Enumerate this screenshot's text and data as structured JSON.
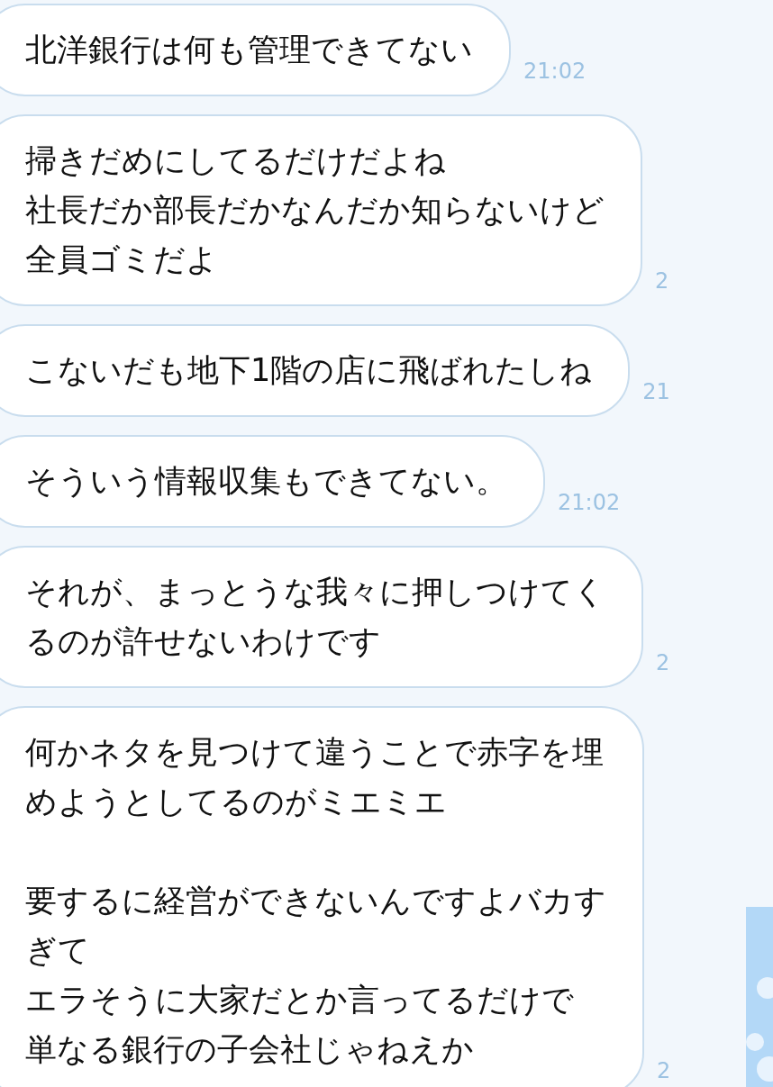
{
  "messages": [
    {
      "paragraphs": [
        [
          "北洋銀行は何も管理できてない"
        ]
      ],
      "time": "21:02"
    },
    {
      "paragraphs": [
        [
          "掃きだめにしてるだけだよね",
          "社長だか部長だかなんだか知らないけど",
          "全員ゴミだよ"
        ]
      ],
      "time": "2"
    },
    {
      "paragraphs": [
        [
          "こないだも地下1階の店に飛ばれたしね"
        ]
      ],
      "time": "21"
    },
    {
      "paragraphs": [
        [
          "そういう情報収集もできてない。"
        ]
      ],
      "time": "21:02"
    },
    {
      "paragraphs": [
        [
          "それが、まっとうな我々に押しつけてく",
          "るのが許せないわけです"
        ]
      ],
      "time": "2"
    },
    {
      "paragraphs": [
        [
          "何かネタを見つけて違うことで赤字を埋",
          "めようとしてるのがミエミエ"
        ],
        [
          "要するに経営ができないんですよバカす",
          "ぎて",
          "エラそうに大家だとか言ってるだけで",
          "単なる銀行の子会社じゃねえか"
        ]
      ],
      "time": "2"
    }
  ]
}
